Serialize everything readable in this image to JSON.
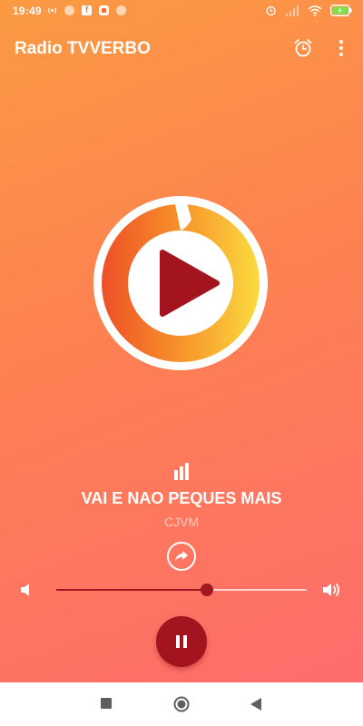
{
  "status_bar": {
    "time": "19:49"
  },
  "app_bar": {
    "title": "Radio TVVERBO",
    "alarm_icon": "alarm-clock-icon",
    "menu_icon": "more-vertical-icon"
  },
  "player": {
    "logo_icon": "play-logo-icon",
    "now_playing_icon": "equalizer-icon",
    "track_title": "VAI E NAO PEQUES MAIS",
    "track_artist": "CJVM",
    "share_icon": "share-icon",
    "volume": {
      "level": 0.6,
      "low_icon": "volume-low-icon",
      "high_icon": "volume-high-icon"
    },
    "state": "playing",
    "pause_icon": "pause-icon"
  },
  "colors": {
    "accent": "#a3141f",
    "background_top": "#fb9a42",
    "background_bottom": "#ff6a6f",
    "logo_ring_left": "#ee4f27",
    "logo_ring_right": "#fbdb3e"
  },
  "nav_bar": {
    "recent_icon": "square-icon",
    "home_icon": "circle-home-icon",
    "back_icon": "back-triangle-icon"
  }
}
